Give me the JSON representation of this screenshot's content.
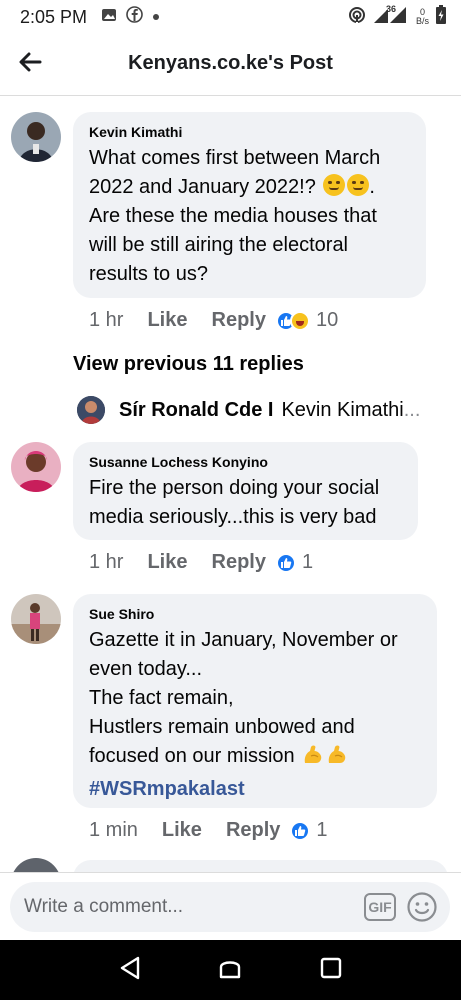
{
  "status_bar": {
    "time": "2:05 PM",
    "network_type": "36",
    "net_speed_value": "0",
    "net_speed_unit": "B/s",
    "icons": [
      "gallery-icon",
      "facebook-icon",
      "dot-icon",
      "hotspot-icon",
      "signal-icon",
      "battery-icon"
    ]
  },
  "header": {
    "title": "Kenyans.co.ke's Post",
    "back_icon": "arrow-left-icon"
  },
  "comments": [
    {
      "author": "Kevin Kimathi",
      "lines": [
        "What comes first between March",
        "2022 and January 2022!? ",
        "Are these the media houses that",
        "will be still airing the electoral",
        "results to us?"
      ],
      "line2_tail": ".",
      "emojis": [
        "smirk-face-icon",
        "smirk-face-icon"
      ],
      "time": "1 hr",
      "like_label": "Like",
      "reply_label": "Reply",
      "reactions": [
        "like-reaction-icon",
        "haha-reaction-icon"
      ],
      "reaction_count": "10"
    },
    {
      "author": "Susanne Lochess Konyino",
      "lines": [
        "Fire the person doing your social",
        "media seriously...this is very bad"
      ],
      "time": "1 hr",
      "like_label": "Like",
      "reply_label": "Reply",
      "reactions": [
        "like-reaction-icon"
      ],
      "reaction_count": "1"
    },
    {
      "author": "Sue Shiro",
      "lines": [
        "Gazette it in January, November or",
        "even today...",
        "The fact remain,",
        "Hustlers remain unbowed and",
        "focused on our mission "
      ],
      "hashtag": "#WSRmpakalast",
      "emojis": [
        "flexed-biceps-icon",
        "flexed-biceps-icon"
      ],
      "time": "1 min",
      "like_label": "Like",
      "reply_label": "Reply",
      "reactions": [
        "like-reaction-icon"
      ],
      "reaction_count": "1"
    }
  ],
  "view_previous": "View previous 11 replies",
  "reply_preview": {
    "name": "Sír Ronald Cde I",
    "text": "Kevin Kimathi",
    "ellipsis": "..."
  },
  "composer": {
    "placeholder": "Write a comment...",
    "gif_label": "GIF",
    "emoji_icon": "smiley-icon"
  },
  "nav": {
    "icons": [
      "back-triangle-icon",
      "home-icon",
      "recents-square-icon"
    ]
  },
  "colors": {
    "bubble": "#f0f2f5",
    "link_blue": "#385898",
    "fb_blue": "#1877f2",
    "muted": "#65676b"
  }
}
